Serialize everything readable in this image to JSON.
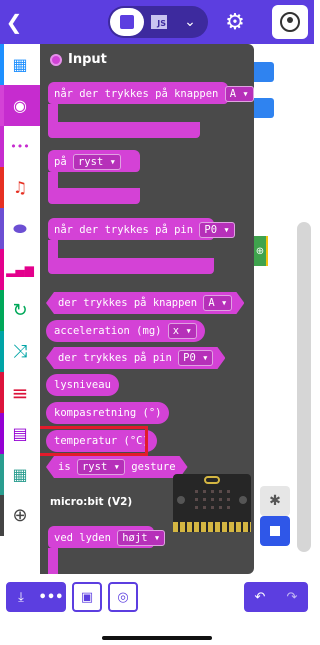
{
  "header": {
    "back_icon": "chevron-left-icon",
    "logo_icon": "microsoft-logo-icon",
    "editor_toggle": {
      "blocks_icon": "blocks-icon",
      "js_label": "JS",
      "chevron": "⌄"
    },
    "settings_icon": "gear-icon",
    "user_icon": "user-icon",
    "colors": {
      "bar": "#5c3ee0"
    }
  },
  "categories": [
    {
      "name": "basic",
      "icon": "grid-icon",
      "glyph": "▦",
      "color": "#1e90ff"
    },
    {
      "name": "input",
      "icon": "input-icon",
      "glyph": "◉",
      "color": "#d442d6",
      "active": true
    },
    {
      "name": "led",
      "icon": "dots-icon",
      "glyph": "•••",
      "color": "#c62ccf"
    },
    {
      "name": "music",
      "icon": "headphones-icon",
      "glyph": "♫",
      "color": "#e63022"
    },
    {
      "name": "logic-toggle",
      "icon": "toggle-icon",
      "glyph": "⬭",
      "color": "#6c4fd3"
    },
    {
      "name": "radio",
      "icon": "signal-icon",
      "glyph": "▁▃▅",
      "color": "#e3008c"
    },
    {
      "name": "loops",
      "icon": "loop-icon",
      "glyph": "↻",
      "color": "#00a859"
    },
    {
      "name": "logic",
      "icon": "shuffle-icon",
      "glyph": "⤨",
      "color": "#00a4a6"
    },
    {
      "name": "variables",
      "icon": "list-icon",
      "glyph": "≡",
      "color": "#dc143c"
    },
    {
      "name": "math",
      "icon": "calculator-icon",
      "glyph": "▤",
      "color": "#9400d3"
    },
    {
      "name": "arrays",
      "icon": "table-icon",
      "glyph": "▦",
      "color": "#2a9d8f"
    },
    {
      "name": "extensions",
      "icon": "plus-circle-icon",
      "glyph": "⊕",
      "color": "#444444"
    }
  ],
  "flyout": {
    "title": "Input",
    "blocks": {
      "hat1_text": "når der trykkes på knappen",
      "hat1_drop": "A",
      "hat2_text": "på",
      "hat2_drop": "ryst",
      "hat3_text": "når der trykkes på pin",
      "hat3_drop": "P0",
      "r1_text": "der trykkes på knappen",
      "r1_drop": "A",
      "r2_text": "acceleration (mg)",
      "r2_drop": "x",
      "r3_text": "der trykkes på pin",
      "r3_drop": "P0",
      "r4_text": "lysniveau",
      "r5_text": "kompasretning (°)",
      "r6_text": "temperatur (°C)",
      "r7_pre": "is",
      "r7_drop": "ryst",
      "r7_post": "gesture",
      "section": "micro:bit (V2)",
      "r8_text": "ved lyden",
      "r8_drop": "højt"
    },
    "highlight_color": "#e21b2b"
  },
  "workspace": {
    "debug_icon": "bug-icon",
    "stop_icon": "stop-icon",
    "simulator": "micro:bit"
  },
  "bottom": {
    "download_icon": "download-icon",
    "more_label": "•••",
    "save_icon": "save-icon",
    "github_icon": "github-icon",
    "undo_icon": "undo-icon",
    "redo_icon": "redo-icon"
  }
}
